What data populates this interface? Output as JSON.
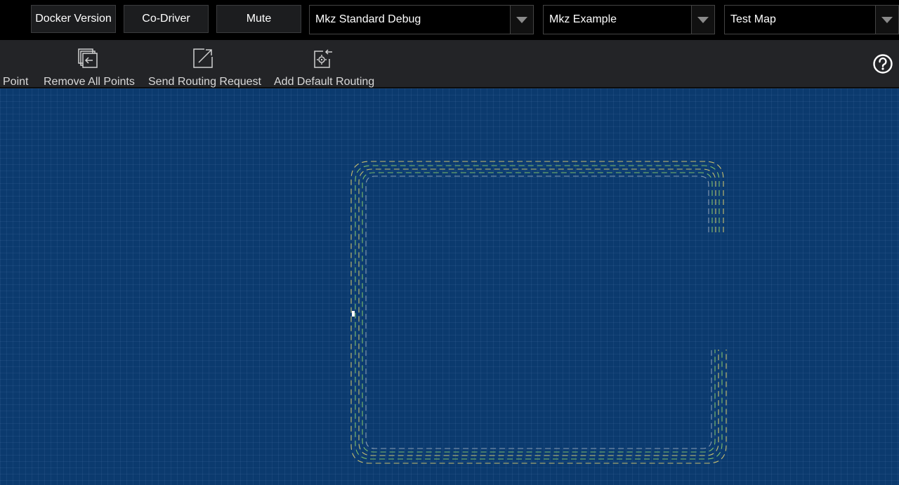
{
  "header": {
    "buttons": [
      {
        "label": "Docker Version"
      },
      {
        "label": "Co-Driver"
      },
      {
        "label": "Mute"
      }
    ],
    "selects": [
      {
        "value": "Mkz Standard Debug"
      },
      {
        "value": "Mkz Example"
      },
      {
        "value": "Test Map"
      }
    ]
  },
  "toolbar": {
    "tools": [
      {
        "label": "Point",
        "icon": "point-icon"
      },
      {
        "label": "Remove All Points",
        "icon": "remove-all-points-icon"
      },
      {
        "label": "Send Routing Request",
        "icon": "send-routing-request-icon"
      },
      {
        "label": "Add Default Routing",
        "icon": "add-default-routing-icon"
      }
    ],
    "help_icon": "question-circle-icon"
  },
  "map": {
    "background_color": "#0b3a6e",
    "lane_colors": [
      "#c9c070",
      "#7fbf6a",
      "#d9d9d9"
    ]
  }
}
